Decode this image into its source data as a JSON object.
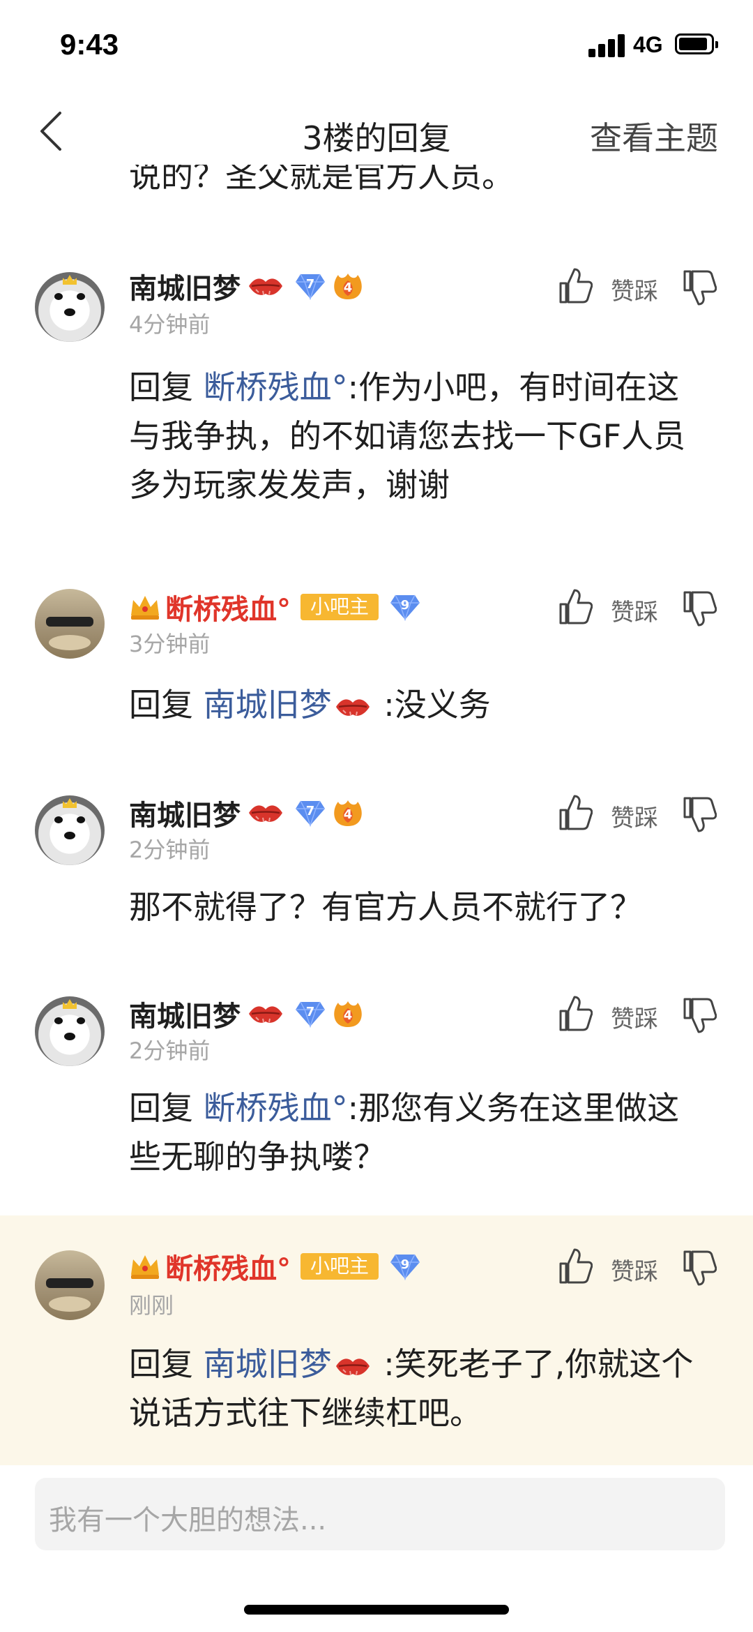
{
  "status_bar": {
    "time": "9:43",
    "network": "4G"
  },
  "nav": {
    "title": "3楼的回复",
    "right_action": "查看主题"
  },
  "partial_text": "说的？圣父就是官方人员。",
  "vote_label": "赞踩",
  "owner_label": "小吧主",
  "replies": [
    {
      "user": "南城旧梦",
      "gem_level": "7",
      "flame_level": "4",
      "time": "4分钟前",
      "prefix": "回复 ",
      "mention": "断桥残血°",
      "text": ":作为小吧，有时间在这与我争执，的不如请您去找一下GF人员多为玩家发发声，谢谢"
    },
    {
      "user": "断桥残血°",
      "gem_level": "9",
      "time": "3分钟前",
      "prefix": "回复 ",
      "mention": "南城旧梦",
      "text": " :没义务"
    },
    {
      "user": "南城旧梦",
      "gem_level": "7",
      "flame_level": "4",
      "time": "2分钟前",
      "text": "那不就得了？有官方人员不就行了？"
    },
    {
      "user": "南城旧梦",
      "gem_level": "7",
      "flame_level": "4",
      "time": "2分钟前",
      "prefix": "回复 ",
      "mention": "断桥残血°",
      "text": ":那您有义务在这里做这些无聊的争执喽？"
    },
    {
      "user": "断桥残血°",
      "gem_level": "9",
      "time": "刚刚",
      "prefix": "回复 ",
      "mention": "南城旧梦",
      "text": " :笑死老子了,你就这个说话方式往下继续杠吧。"
    }
  ],
  "input": {
    "placeholder": "我有一个大胆的想法..."
  },
  "colors": {
    "username_owner": "#e0352a",
    "mention": "#3b5c9b",
    "owner_badge": "#f7b731",
    "gem": "#5b8def",
    "highlight_bg": "#fcf7e9"
  }
}
